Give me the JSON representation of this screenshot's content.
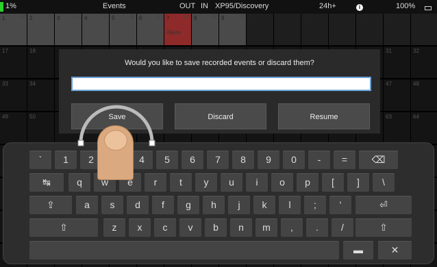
{
  "status_bar": {
    "left_percent": "1%",
    "title": "Events",
    "out_label": "OUT",
    "in_label": "IN",
    "device": "XP95/Discovery",
    "range": "24h+",
    "battery": "100%",
    "info_icon": "info-icon",
    "battery_icon": "battery-icon"
  },
  "grid": {
    "row1": [
      {
        "num": "1",
        "op": "OP"
      },
      {
        "num": "2",
        "op": "OP"
      },
      {
        "num": "3",
        "op": "OP"
      },
      {
        "num": "4",
        "op": "OP"
      },
      {
        "num": "5",
        "op": "OP"
      },
      {
        "num": "6",
        "op": "OP"
      },
      {
        "num": "7",
        "op": "OP",
        "label": "Alarm"
      },
      {
        "num": "8",
        "op": "OP"
      },
      {
        "num": "9",
        "op": "OP"
      },
      {
        "num": "10",
        "op": ""
      },
      {
        "num": "11",
        "op": ""
      },
      {
        "num": "12",
        "op": ""
      },
      {
        "num": "13",
        "op": ""
      },
      {
        "num": "14",
        "op": ""
      },
      {
        "num": "15",
        "op": ""
      },
      {
        "num": "16",
        "op": ""
      }
    ],
    "left_numbers": [
      "17",
      "18",
      "33",
      "34",
      "49",
      "50"
    ],
    "right_numbers": [
      "31",
      "32",
      "47",
      "48",
      "63",
      "64"
    ]
  },
  "dialog": {
    "prompt": "Would you like to save recorded events or discard them?",
    "input_value": "",
    "save_label": "Save",
    "discard_label": "Discard",
    "resume_label": "Resume"
  },
  "keyboard": {
    "row1": [
      "`",
      "1",
      "2",
      "3",
      "4",
      "5",
      "6",
      "7",
      "8",
      "9",
      "0",
      "-",
      "=",
      "⌫"
    ],
    "row2": [
      "↹",
      "q",
      "w",
      "e",
      "r",
      "t",
      "y",
      "u",
      "i",
      "o",
      "p",
      "[",
      "]",
      "\\"
    ],
    "row3": [
      "⇪",
      "a",
      "s",
      "d",
      "f",
      "g",
      "h",
      "j",
      "k",
      "l",
      ";",
      "'",
      "⏎"
    ],
    "row4": [
      "⇧",
      "z",
      "x",
      "c",
      "v",
      "b",
      "n",
      "m",
      ",",
      ".",
      "/",
      "⇧"
    ],
    "row5": {
      "space": "",
      "hide": "▬",
      "close": "✕"
    }
  }
}
